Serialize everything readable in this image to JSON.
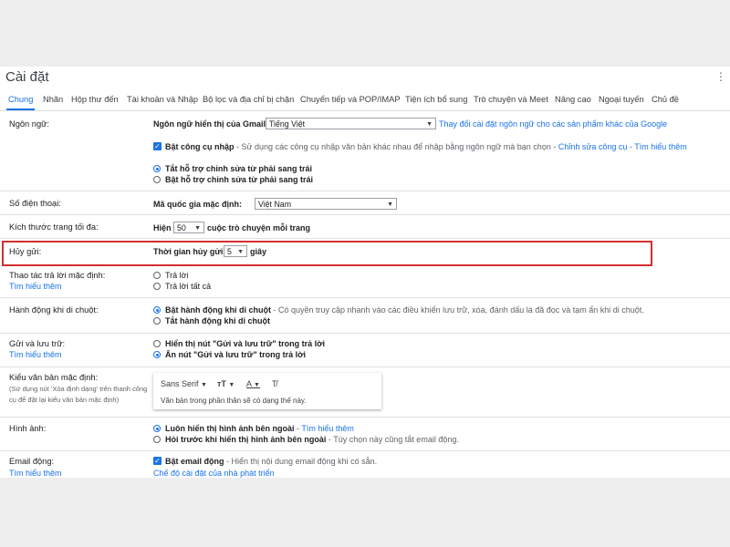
{
  "header": {
    "title": "Cài đặt"
  },
  "tabs": [
    "Chung",
    "Nhãn",
    "Hộp thư đến",
    "Tài khoản và Nhập",
    "Bộ lọc và địa chỉ bị chặn",
    "Chuyển tiếp và POP/IMAP",
    "Tiện ích bổ sung",
    "Trò chuyện và Meet",
    "Nâng cao",
    "Ngoại tuyến",
    "Chủ đề"
  ],
  "language": {
    "label": "Ngôn ngữ:",
    "display_label": "Ngôn ngữ hiển thị của Gmail:",
    "display_value": "Tiếng Việt",
    "change_link": "Thay đổi cài đặt ngôn ngữ cho các sản phẩm khác của Google",
    "input_tools_label": "Bật công cụ nhập",
    "input_tools_desc": " - Sử dụng các công cụ nhập văn bản khác nhau để nhập bằng ngôn ngữ mà bạn chọn - ",
    "edit_tools_link": "Chỉnh sửa công cụ",
    "learn_more": "Tìm hiểu thêm",
    "rtl_off": "Tắt hỗ trợ chỉnh sửa từ phải sang trái",
    "rtl_on": "Bật hỗ trợ chỉnh sửa từ phải sang trái"
  },
  "phone": {
    "label": "Số điện thoại:",
    "country_label": "Mã quốc gia mặc định:",
    "country_value": "Việt Nam"
  },
  "page_size": {
    "label": "Kích thước trang tối đa:",
    "prefix": "Hiện",
    "value": "50",
    "suffix": "cuộc trò chuyện mỗi trang"
  },
  "undo_send": {
    "label": "Hủy gửi:",
    "prefix": "Thời gian hủy gửi:",
    "value": "5",
    "suffix": "giây"
  },
  "reply": {
    "label": "Thao tác trả lời mặc định:",
    "learn_more": "Tìm hiểu thêm",
    "reply": "Trả lời",
    "reply_all": "Trả lời tất cả"
  },
  "hover": {
    "label": "Hành động khi di chuột:",
    "on": "Bật hành động khi di chuột",
    "on_desc": " - Có quyền truy cập nhanh vào các điều khiển lưu trữ, xóa, đánh dấu là đã đọc và tạm ẩn khi di chuột.",
    "off": "Tắt hành động khi di chuột"
  },
  "send_archive": {
    "label": "Gửi và lưu trữ:",
    "learn_more": "Tìm hiểu thêm",
    "show": "Hiển thị nút \"Gửi và lưu trữ\" trong trả lời",
    "hide": "Ẩn nút \"Gửi và lưu trữ\" trong trả lời"
  },
  "text_style": {
    "label": "Kiểu văn bản mặc định:",
    "note1": "(Sử dụng nút 'Xóa định dạng' trên thanh công",
    "note2": "cụ để đặt lại kiểu văn bản mặc định)",
    "font": "Sans Serif",
    "preview": "Văn bản trong phần thân sẽ có dạng thế này."
  },
  "images": {
    "label": "Hình ảnh:",
    "always": "Luôn hiển thị hình ảnh bên ngoài",
    "learn_more": "Tìm hiểu thêm",
    "ask": "Hỏi trước khi hiển thị hình ảnh bên ngoài",
    "ask_desc": " - Tùy chọn này cũng tắt email động."
  },
  "dynamic": {
    "label": "Email động:",
    "learn_more": "Tìm hiểu thêm",
    "enable": "Bật email động",
    "enable_desc": " - Hiển thị nội dung email động khi có sẵn.",
    "dev_link": "Chế độ cài đặt của nhà phát triển"
  },
  "colors": {
    "accent": "#1a73e8",
    "highlight": "#d32f2f"
  }
}
